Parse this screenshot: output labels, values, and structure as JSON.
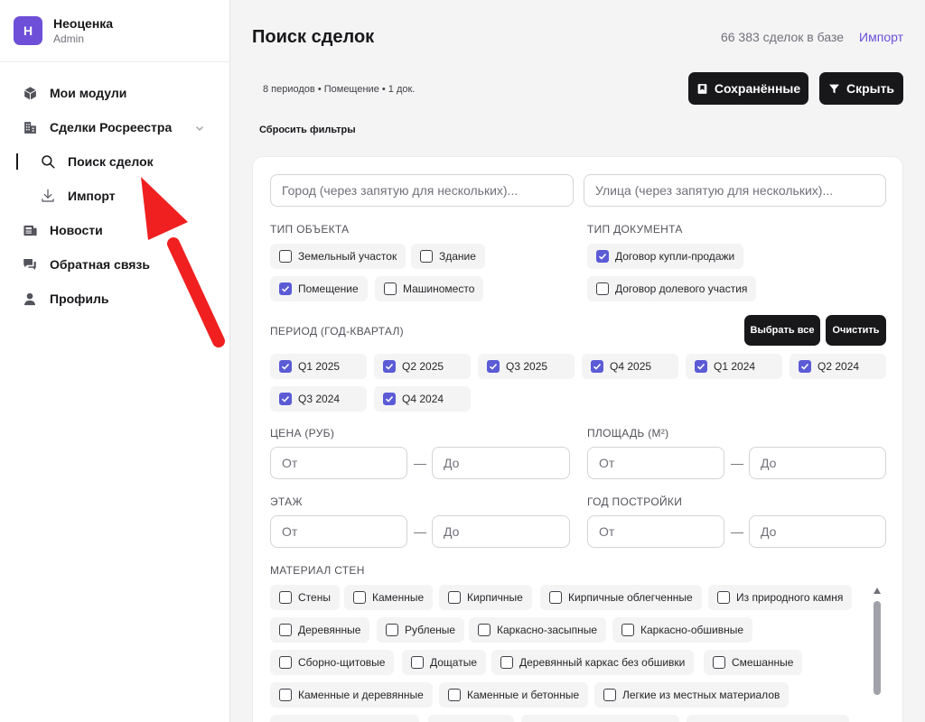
{
  "brand": {
    "initial": "Н",
    "name": "Неоценка",
    "role": "Admin",
    "logo_color": "#6d4fd8"
  },
  "sidebar": {
    "items": [
      {
        "label": "Мои модули",
        "icon": "cube-icon"
      },
      {
        "label": "Сделки Росреестра",
        "icon": "building-icon",
        "expanded": true
      },
      {
        "label": "Поиск сделок",
        "icon": "search-icon",
        "active": true
      },
      {
        "label": "Импорт",
        "icon": "download-icon"
      },
      {
        "label": "Новости",
        "icon": "newspaper-icon"
      },
      {
        "label": "Обратная связь",
        "icon": "chat-icon"
      },
      {
        "label": "Профиль",
        "icon": "user-icon"
      }
    ]
  },
  "header": {
    "title": "Поиск сделок",
    "count": "66 383 сделок в базе",
    "import_link": "Импорт",
    "summary": "8 периодов • Помещение • 1 док.",
    "reset": "Сбросить фильтры",
    "saved_button": "Сохранённые",
    "hide_button": "Скрыть"
  },
  "filters": {
    "city_placeholder": "Город (через запятую для нескольких)...",
    "street_placeholder": "Улица (через запятую для нескольких)...",
    "object_type": {
      "label": "Тип объекта",
      "options": [
        {
          "label": "Земельный участок",
          "checked": false
        },
        {
          "label": "Здание",
          "checked": false
        },
        {
          "label": "Помещение",
          "checked": true
        },
        {
          "label": "Машиноместо",
          "checked": false
        }
      ]
    },
    "doc_type": {
      "label": "Тип документа",
      "options": [
        {
          "label": "Договор купли-продажи",
          "checked": true
        },
        {
          "label": "Договор долевого участия",
          "checked": false
        }
      ]
    },
    "period": {
      "label": "Период (год-квартал)",
      "select_all": "Выбрать все",
      "clear": "Очистить",
      "options": [
        {
          "label": "Q1 2025",
          "checked": true
        },
        {
          "label": "Q2 2025",
          "checked": true
        },
        {
          "label": "Q3 2025",
          "checked": true
        },
        {
          "label": "Q4 2025",
          "checked": true
        },
        {
          "label": "Q1 2024",
          "checked": true
        },
        {
          "label": "Q2 2024",
          "checked": true
        },
        {
          "label": "Q3 2024",
          "checked": true
        },
        {
          "label": "Q4 2024",
          "checked": true
        }
      ]
    },
    "price": {
      "label": "Цена (руб)",
      "from": "От",
      "to": "До"
    },
    "area": {
      "label": "Площадь (м²)",
      "from": "От",
      "to": "До"
    },
    "floor": {
      "label": "Этаж",
      "from": "От",
      "to": "До"
    },
    "year": {
      "label": "Год постройки",
      "from": "От",
      "to": "До"
    },
    "dash": "—",
    "walls": {
      "label": "Материал стен",
      "options": [
        {
          "label": "Стены",
          "checked": false
        },
        {
          "label": "Каменные",
          "checked": false
        },
        {
          "label": "Кирпичные",
          "checked": false
        },
        {
          "label": "Кирпичные облегченные",
          "checked": false
        },
        {
          "label": "Из природного камня",
          "checked": false
        },
        {
          "label": "Деревянные",
          "checked": false
        },
        {
          "label": "Рубленые",
          "checked": false
        },
        {
          "label": "Каркасно-засыпные",
          "checked": false
        },
        {
          "label": "Каркасно-обшивные",
          "checked": false
        },
        {
          "label": "Сборно-щитовые",
          "checked": false
        },
        {
          "label": "Дощатые",
          "checked": false
        },
        {
          "label": "Деревянный каркас без обшивки",
          "checked": false
        },
        {
          "label": "Смешанные",
          "checked": false
        },
        {
          "label": "Каменные и деревянные",
          "checked": false
        },
        {
          "label": "Каменные и бетонные",
          "checked": false
        },
        {
          "label": "Легкие из местных материалов",
          "checked": false
        }
      ]
    }
  },
  "colors": {
    "accent": "#5b5bd6",
    "dark_button": "#18181b",
    "link": "#6d4fd8",
    "annotation_arrow": "#f02020"
  }
}
